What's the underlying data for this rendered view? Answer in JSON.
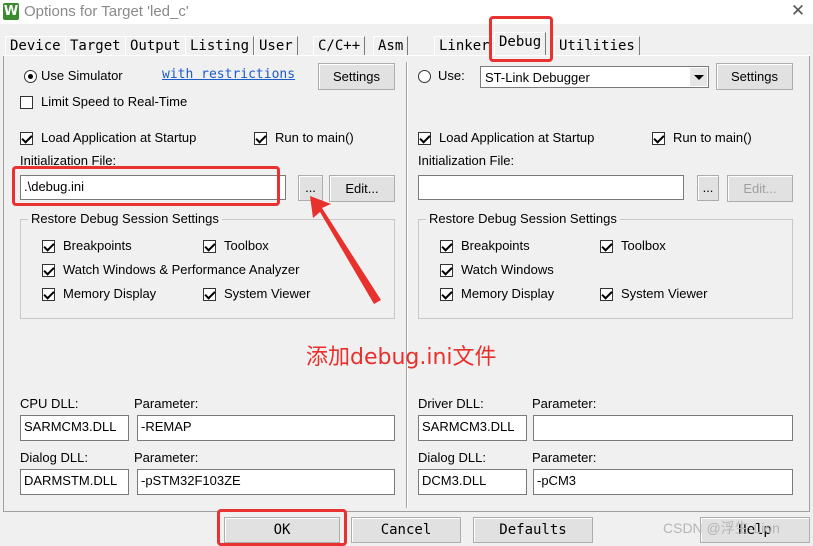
{
  "window": {
    "title": "Options for Target 'led_c'",
    "close_glyph": "✕",
    "app_icon_glyph": "W"
  },
  "tabs": [
    {
      "label": "Device"
    },
    {
      "label": "Target"
    },
    {
      "label": "Output"
    },
    {
      "label": "Listing"
    },
    {
      "label": "User"
    },
    {
      "label": "C/C++"
    },
    {
      "label": "Asm"
    },
    {
      "label": "Linker"
    },
    {
      "label": "Debug",
      "active": true
    },
    {
      "label": "Utilities"
    }
  ],
  "left": {
    "use_simulator": "Use Simulator",
    "with_restrictions": "with restrictions",
    "settings": "Settings",
    "limit_speed": "Limit Speed to Real-Time",
    "load_app": "Load Application at Startup",
    "run_to_main": "Run to main()",
    "init_file_label": "Initialization File:",
    "init_file_value": ".\\debug.ini",
    "browse": "...",
    "edit": "Edit...",
    "restore_title": "Restore Debug Session Settings",
    "breakpoints": "Breakpoints",
    "toolbox": "Toolbox",
    "watch_windows": "Watch Windows & Performance Analyzer",
    "memory_display": "Memory Display",
    "system_viewer": "System Viewer",
    "cpu_dll_label": "CPU DLL:",
    "cpu_param_label": "Parameter:",
    "cpu_dll": "SARMCM3.DLL",
    "cpu_param": "-REMAP",
    "dialog_dll_label": "Dialog DLL:",
    "dialog_param_label": "Parameter:",
    "dialog_dll": "DARMSTM.DLL",
    "dialog_param": "-pSTM32F103ZE"
  },
  "right": {
    "use_label": "Use:",
    "debugger": "ST-Link Debugger",
    "settings": "Settings",
    "load_app": "Load Application at Startup",
    "run_to_main": "Run to main()",
    "init_file_label": "Initialization File:",
    "init_file_value": "",
    "browse": "...",
    "edit": "Edit...",
    "restore_title": "Restore Debug Session Settings",
    "breakpoints": "Breakpoints",
    "toolbox": "Toolbox",
    "watch_windows": "Watch Windows",
    "memory_display": "Memory Display",
    "system_viewer": "System Viewer",
    "driver_dll_label": "Driver DLL:",
    "driver_param_label": "Parameter:",
    "driver_dll": "SARMCM3.DLL",
    "driver_param": "",
    "dialog_dll_label": "Dialog DLL:",
    "dialog_param_label": "Parameter:",
    "dialog_dll": "DCM3.DLL",
    "dialog_param": "-pCM3"
  },
  "footer": {
    "ok": "OK",
    "cancel": "Cancel",
    "defaults": "Defaults",
    "help": "Help"
  },
  "annotation": {
    "text": "添加debug.ini文件",
    "color": "#e8302c"
  },
  "watermark": "CSDN @浮生-Lion"
}
